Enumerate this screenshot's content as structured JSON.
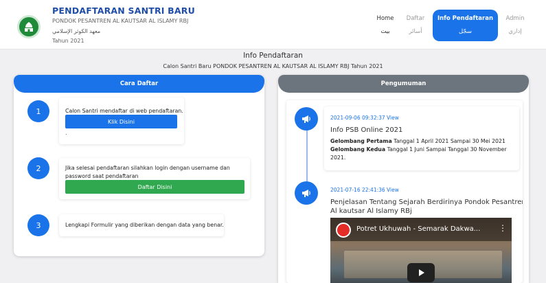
{
  "header": {
    "title": "PENDAFTARAN SANTRI BARU",
    "subtitle": "PONDOK PESANTREN AL KAUTSAR AL ISLAMY RBJ",
    "arabic": "معهد الكوثر الإسلامي",
    "year": "Tahun 2021"
  },
  "nav": {
    "home": {
      "en": "Home",
      "ar": "بيت"
    },
    "daftar": {
      "en": "Daftar",
      "ar": "أسائر"
    },
    "info": {
      "en": "Info Pendaftaran",
      "ar": "سجّل"
    },
    "admin": {
      "en": "Admin",
      "ar": "إداري"
    }
  },
  "page": {
    "title": "Info Pendaftaran",
    "subtitle": "Calon Santri Baru PONDOK PESANTREN AL KAUTSAR AL ISLAMY RBJ Tahun 2021"
  },
  "cara": {
    "header": "Cara Daftar",
    "steps": [
      {
        "num": "1",
        "text": "Calon Santri mendaftar di web pendaftaran.",
        "button": "Klik Disini",
        "dot": "."
      },
      {
        "num": "2",
        "text_line1": "Jika selesai pendaftaran silahkan login dengan username dan",
        "text_line2": "password saat pendaftaran",
        "button": "Daftar Disini"
      },
      {
        "num": "3",
        "text": "Lengkapi Formulir yang diberikan dengan data yang benar."
      }
    ]
  },
  "pengumuman": {
    "header": "Pengumuman",
    "items": [
      {
        "meta": "2021-09-06 09:32:37 View",
        "title": "Info PSB Online 2021",
        "line1_bold": "Gelombang Pertama",
        "line1_rest": " Tanggal 1 April 2021 Sampai 30 Mei 2021",
        "line2_bold": "Gelombang Kedua",
        "line2_rest": " Tanggal 1 Juni Sampai Tanggal 30 November",
        "line3": "2021."
      },
      {
        "meta": "2021-07-16 22:41:36 View",
        "title_line1": "Penjelasan Tentang Sejarah Berdirinya Pondok Pesantren",
        "title_line2": "Al kautsar Al Islamy RBj",
        "video_title": "Potret Ukhuwah - Semarak Dakwa..."
      }
    ]
  },
  "colors": {
    "primary": "#1a73e8",
    "success": "#2fa84f",
    "secondary": "#6c757d",
    "brand_title": "#1f4ea8"
  },
  "icons": {
    "logo": "mosque-logo-icon",
    "announce": "megaphone-icon",
    "play": "play-icon",
    "menu": "more-vert-icon"
  }
}
